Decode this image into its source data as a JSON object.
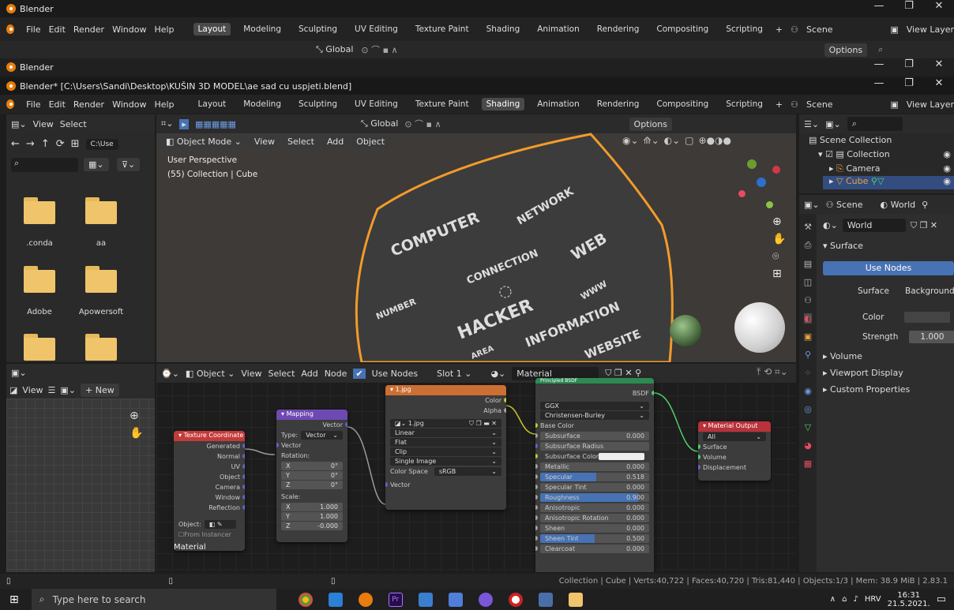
{
  "outer_window": {
    "title": "Blender",
    "minimize": "—",
    "maximize": "❐",
    "close": "✕"
  },
  "outer_menu": [
    "File",
    "Edit",
    "Render",
    "Window",
    "Help"
  ],
  "outer_tabs": [
    "Layout",
    "Modeling",
    "Sculpting",
    "UV Editing",
    "Texture Paint",
    "Shading",
    "Animation",
    "Rendering",
    "Compositing",
    "Scripting"
  ],
  "outer_active_tab": "Layout",
  "scene_name": "Scene",
  "view_layer": "View Layer",
  "outer_toolbar": {
    "transform": "Global",
    "options": "Options"
  },
  "second_window": {
    "title": "Blender"
  },
  "inner_window": {
    "title": "Blender* [C:\\Users\\Sandi\\Desktop\\KUŠIN 3D MODEL\\ae sad cu uspjeti.blend]"
  },
  "inner_menu": [
    "File",
    "Edit",
    "Render",
    "Window",
    "Help"
  ],
  "inner_tabs": [
    "Layout",
    "Modeling",
    "Sculpting",
    "UV Editing",
    "Texture Paint",
    "Shading",
    "Animation",
    "Rendering",
    "Compositing",
    "Scripting"
  ],
  "inner_active_tab": "Shading",
  "file_browser": {
    "view": "View",
    "select": "Select",
    "path": "C:\\Use",
    "folders": [
      ".conda",
      "aa",
      "Adobe",
      "Apowersoft"
    ]
  },
  "viewport": {
    "mode": "Object Mode",
    "menu": [
      "View",
      "Select",
      "Add",
      "Object"
    ],
    "transform": "Global",
    "options": "Options",
    "info_line1": "User Perspective",
    "info_line2": "(55) Collection | Cube",
    "pillow_words": [
      "COMPUTER",
      "CONNECTION",
      "NETWORK",
      "WEB",
      "HACKER",
      "INFORMATION",
      "WEBSITE",
      "NUMBER",
      "WWW",
      "AREA"
    ]
  },
  "image_editor": {
    "view": "View",
    "new_label": "New"
  },
  "node_editor": {
    "object": "Object",
    "menu": [
      "View",
      "Select",
      "Add",
      "Node"
    ],
    "use_nodes": "Use Nodes",
    "slot": "Slot 1",
    "material": "Material",
    "footer_label": "Material"
  },
  "nodes": {
    "texcoord": {
      "title": "Texture Coordinate",
      "outputs": [
        "Generated",
        "Normal",
        "UV",
        "Object",
        "Camera",
        "Window",
        "Reflection"
      ],
      "object_label": "Object:",
      "from_instancer": "From Instancer"
    },
    "mapping": {
      "title": "Mapping",
      "output": "Vector",
      "type_label": "Type:",
      "type_value": "Vector",
      "input": "Vector",
      "rotation_label": "Rotation:",
      "rotation": [
        {
          "axis": "X",
          "value": "0°"
        },
        {
          "axis": "Y",
          "value": "0°"
        },
        {
          "axis": "Z",
          "value": "0°"
        }
      ],
      "scale_label": "Scale:",
      "scale": [
        {
          "axis": "X",
          "value": "1.000"
        },
        {
          "axis": "Y",
          "value": "1.000"
        },
        {
          "axis": "Z",
          "value": "-0.000"
        }
      ]
    },
    "image": {
      "title": "1.jpg",
      "outputs": [
        "Color",
        "Alpha"
      ],
      "image_name": "1.jpg",
      "interpolation": "Linear",
      "projection": "Flat",
      "extension": "Clip",
      "source": "Single Image",
      "color_space_label": "Color Space",
      "color_space": "sRGB",
      "input": "Vector"
    },
    "bsdf": {
      "title": "Principled BSDF",
      "output": "BSDF",
      "distribution": "GGX",
      "subsurface_method": "Christensen-Burley",
      "base_color": "Base Color",
      "rows": [
        {
          "label": "Subsurface",
          "value": "0.000",
          "fill": 0
        },
        {
          "label": "Subsurface Radius",
          "value": "",
          "fill": 0
        },
        {
          "label": "Subsurface Color",
          "value": "",
          "fill": 0
        },
        {
          "label": "Metallic",
          "value": "0.000",
          "fill": 0
        },
        {
          "label": "Specular",
          "value": "0.518",
          "fill": 0.518
        },
        {
          "label": "Specular Tint",
          "value": "0.000",
          "fill": 0
        },
        {
          "label": "Roughness",
          "value": "0.900",
          "fill": 0.9
        },
        {
          "label": "Anisotropic",
          "value": "0.000",
          "fill": 0
        },
        {
          "label": "Anisotropic Rotation",
          "value": "0.000",
          "fill": 0
        },
        {
          "label": "Sheen",
          "value": "0.000",
          "fill": 0
        },
        {
          "label": "Sheen Tint",
          "value": "0.500",
          "fill": 0.5
        },
        {
          "label": "Clearcoat",
          "value": "0.000",
          "fill": 0
        }
      ]
    },
    "output": {
      "title": "Material Output",
      "target": "All",
      "inputs": [
        "Surface",
        "Volume",
        "Displacement"
      ]
    }
  },
  "outliner": {
    "root": "Scene Collection",
    "collection": "Collection",
    "camera": "Camera",
    "cube": "Cube"
  },
  "properties": {
    "scene": "Scene",
    "world_tab": "World",
    "world": "World",
    "surface_section": "Surface",
    "use_nodes": "Use Nodes",
    "surface_label": "Surface",
    "surface_value": "Background",
    "color_label": "Color",
    "strength_label": "Strength",
    "strength_value": "1.000",
    "sections": [
      "Volume",
      "Viewport Display",
      "Custom Properties"
    ]
  },
  "status_bar": "Collection | Cube | Verts:40,722 | Faces:40,720 | Tris:81,440 | Objects:1/3 | Mem: 38.9 MiB | 2.83.1",
  "taskbar": {
    "search": "Type here to search",
    "lang": "HRV",
    "time": "16:31",
    "date": "21.5.2021."
  },
  "colors": {
    "accent": "#4772b3",
    "orange": "#e87d0d",
    "texcoord_header": "#c33a3a",
    "mapping_header": "#6f49b3",
    "image_header": "#cc6f33",
    "bsdf_header": "#2e8a53",
    "output_header": "#b8323a"
  }
}
